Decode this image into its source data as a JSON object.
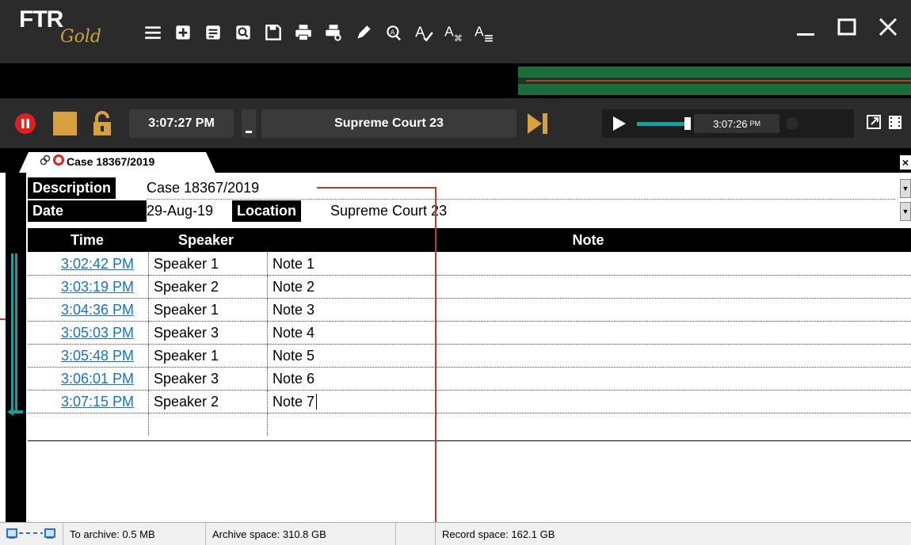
{
  "app": {
    "brand": "FTR",
    "edition": "Gold"
  },
  "toolbar": {
    "icons": [
      "menu-icon",
      "new-record-icon",
      "notes-icon",
      "search-notes-icon",
      "save-icon",
      "print-icon",
      "print-preview-icon",
      "pen-icon",
      "find-icon",
      "spellcheck-icon",
      "shortcut-icon",
      "format-list-icon"
    ]
  },
  "recorder": {
    "clock": "3:07:27 PM",
    "location": "Supreme Court 23",
    "playback_time": "3:07:26",
    "playback_ampm": "PM"
  },
  "tab": {
    "title": "Case 18367/2019",
    "close": "×"
  },
  "meta": {
    "description_label": "Description",
    "description_value": "Case 18367/2019",
    "date_label": "Date",
    "date_value": "29-Aug-19",
    "location_label": "Location",
    "location_value": "Supreme Court 23"
  },
  "table": {
    "headers": {
      "time": "Time",
      "speaker": "Speaker",
      "note": "Note"
    },
    "rows": [
      {
        "time": "3:02:42 PM",
        "speaker": "Speaker 1",
        "note": "Note 1"
      },
      {
        "time": "3:03:19 PM",
        "speaker": "Speaker 2",
        "note": "Note 2"
      },
      {
        "time": "3:04:36 PM",
        "speaker": "Speaker 1",
        "note": "Note 3"
      },
      {
        "time": "3:05:03 PM",
        "speaker": "Speaker 3",
        "note": "Note 4"
      },
      {
        "time": "3:05:48 PM",
        "speaker": "Speaker 1",
        "note": "Note 5"
      },
      {
        "time": "3:06:01 PM",
        "speaker": "Speaker 3",
        "note": "Note 6"
      },
      {
        "time": "3:07:15 PM",
        "speaker": "Speaker 2",
        "note": "Note 7"
      }
    ]
  },
  "status": {
    "to_archive": "To archive: 0.5 MB",
    "archive_space": "Archive space: 310.8 GB",
    "record_space": "Record space: 162.1 GB"
  },
  "colors": {
    "accent": "#17a0a0",
    "record": "#e02020",
    "gold": "#d9a040",
    "link": "#1a6fd1"
  }
}
